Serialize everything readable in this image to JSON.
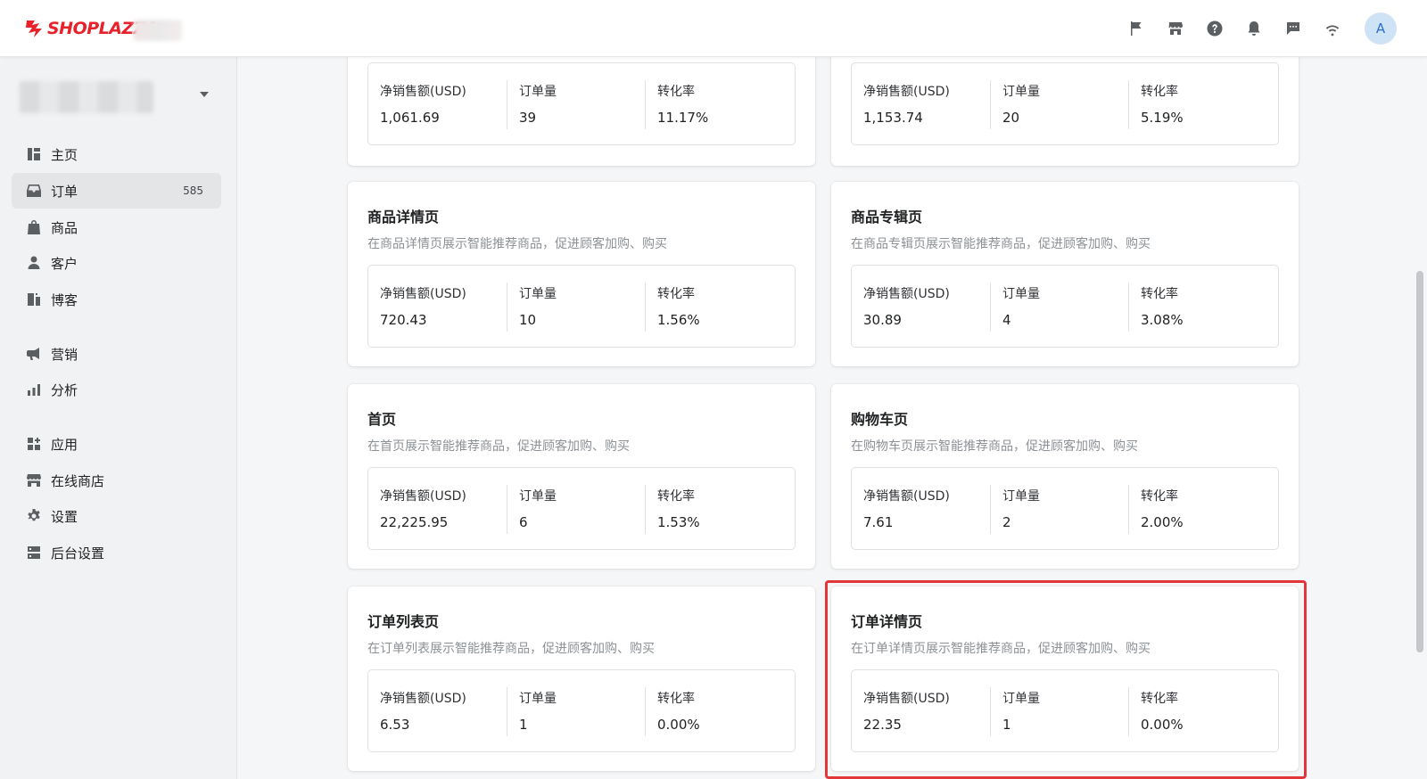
{
  "brand": {
    "name": "SHOPLAZZA",
    "color": "#e8222b"
  },
  "topbar": {
    "icons": [
      "flag-icon",
      "store-icon",
      "help-icon",
      "bell-icon",
      "message-icon",
      "wifi-icon"
    ],
    "avatar_letter": "A"
  },
  "sidebar": {
    "items": [
      {
        "label": "主页",
        "icon": "home-icon",
        "active": false
      },
      {
        "label": "订单",
        "icon": "inbox-icon",
        "active": true,
        "badge": "585"
      },
      {
        "label": "商品",
        "icon": "bag-icon",
        "active": false
      },
      {
        "label": "客户",
        "icon": "person-icon",
        "active": false
      },
      {
        "label": "博客",
        "icon": "blog-icon",
        "active": false
      },
      {
        "label": "营销",
        "icon": "megaphone-icon",
        "active": false
      },
      {
        "label": "分析",
        "icon": "bar-chart-icon",
        "active": false
      },
      {
        "label": "应用",
        "icon": "apps-icon",
        "active": false
      },
      {
        "label": "在线商店",
        "icon": "storefront-icon",
        "active": false
      },
      {
        "label": "设置",
        "icon": "gear-icon",
        "active": false
      },
      {
        "label": "后台设置",
        "icon": "server-icon",
        "active": false
      }
    ]
  },
  "stat_labels": {
    "sales": "净销售额(USD)",
    "orders": "订单量",
    "rate": "转化率"
  },
  "cards": [
    {
      "title": "",
      "desc": "",
      "sales": "1,061.69",
      "orders": "39",
      "rate": "11.17%"
    },
    {
      "title": "",
      "desc": "",
      "sales": "1,153.74",
      "orders": "20",
      "rate": "5.19%"
    },
    {
      "title": "商品详情页",
      "desc": "在商品详情页展示智能推荐商品，促进顾客加购、购买",
      "sales": "720.43",
      "orders": "10",
      "rate": "1.56%"
    },
    {
      "title": "商品专辑页",
      "desc": "在商品专辑页展示智能推荐商品，促进顾客加购、购买",
      "sales": "30.89",
      "orders": "4",
      "rate": "3.08%"
    },
    {
      "title": "首页",
      "desc": "在首页展示智能推荐商品，促进顾客加购、购买",
      "sales": "22,225.95",
      "orders": "6",
      "rate": "1.53%"
    },
    {
      "title": "购物车页",
      "desc": "在购物车页展示智能推荐商品，促进顾客加购、购买",
      "sales": "7.61",
      "orders": "2",
      "rate": "2.00%"
    },
    {
      "title": "订单列表页",
      "desc": "在订单列表展示智能推荐商品，促进顾客加购、购买",
      "sales": "6.53",
      "orders": "1",
      "rate": "0.00%"
    },
    {
      "title": "订单详情页",
      "desc": "在订单详情页展示智能推荐商品，促进顾客加购、购买",
      "sales": "22.35",
      "orders": "1",
      "rate": "0.00%",
      "highlighted": true
    }
  ],
  "colors": {
    "highlight": "#e3363a",
    "avatar_bg": "#cfe3f7",
    "active_nav": "#e4e5e7"
  }
}
